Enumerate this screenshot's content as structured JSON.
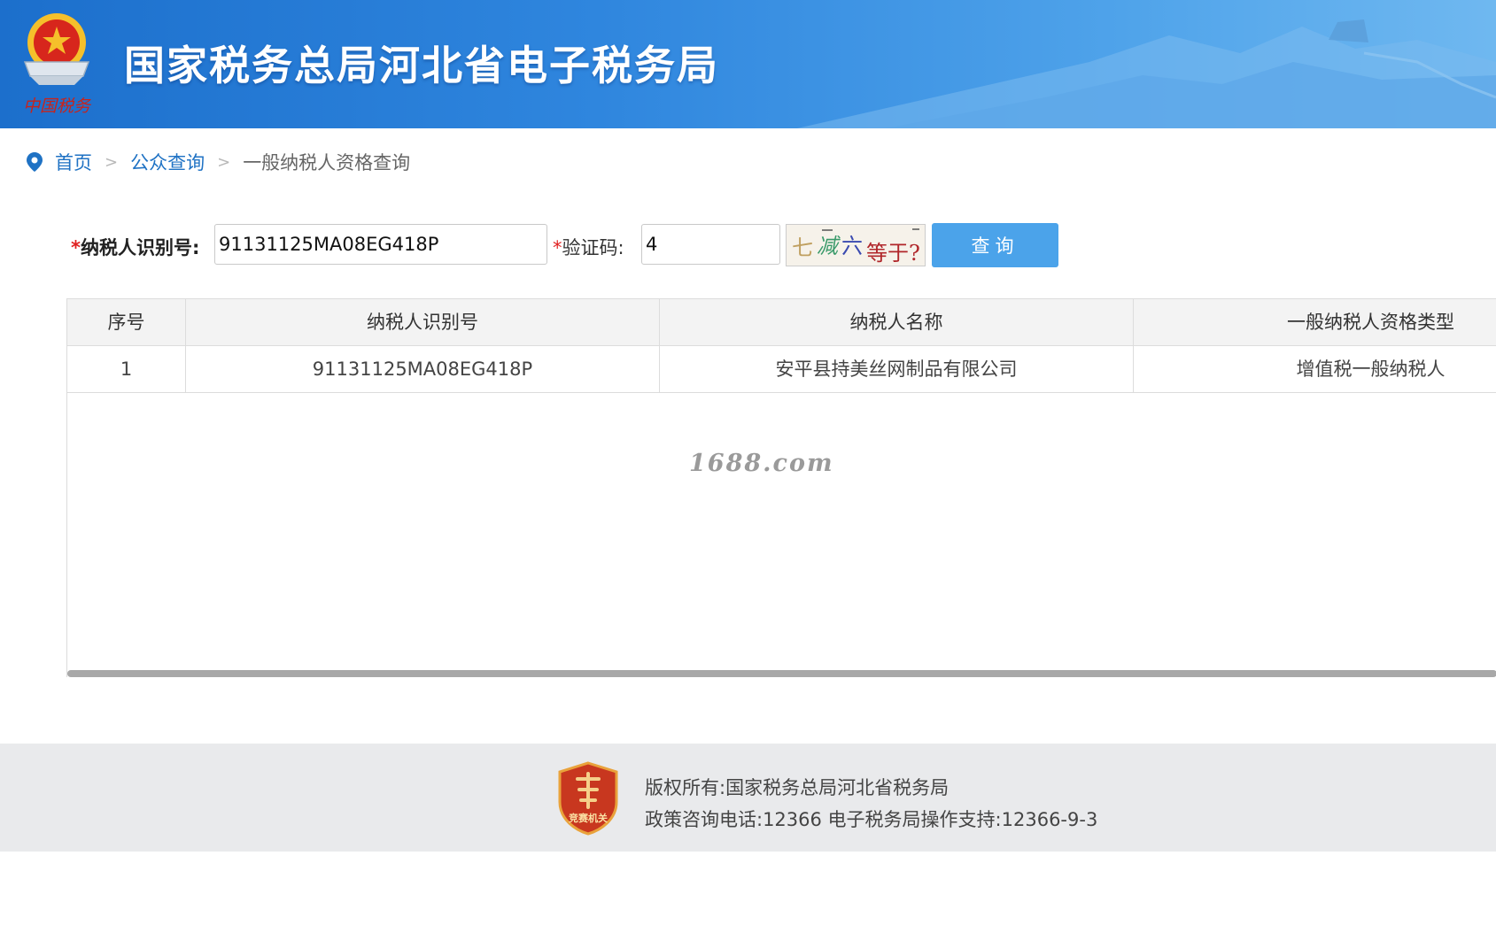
{
  "header": {
    "title": "国家税务总局河北省电子税务局",
    "emblem_caption": "中国税务"
  },
  "breadcrumb": {
    "icon": "location-pin-icon",
    "items": [
      {
        "label": "首页"
      },
      {
        "label": "公众查询"
      },
      {
        "label": "一般纳税人资格查询"
      }
    ],
    "separator": ">"
  },
  "form": {
    "taxpayer_id_label": "纳税人识别号:",
    "taxpayer_id_value": "91131125MA08EG418P",
    "captcha_label": "验证码:",
    "captcha_value": "4",
    "captcha_text": [
      "七",
      "减",
      "六",
      "等于?"
    ],
    "query_button": "查询"
  },
  "table": {
    "columns": [
      "序号",
      "纳税人识别号",
      "纳税人名称",
      "一般纳税人资格类型"
    ],
    "rows": [
      [
        "1",
        "91131125MA08EG418P",
        "安平县持美丝网制品有限公司",
        "增值税一般纳税人"
      ]
    ]
  },
  "watermark": "1688.com",
  "footer": {
    "badge_caption": "竞赛机关",
    "copyright": "版权所有:国家税务总局河北省税务局",
    "support": "政策咨询电话:12366  电子税务局操作支持:12366-9-3"
  },
  "colors": {
    "banner": "#2f86de",
    "link": "#1f72c4",
    "button": "#4ba3ea",
    "required": "#e02020",
    "footer_bg": "#e9eaec"
  }
}
